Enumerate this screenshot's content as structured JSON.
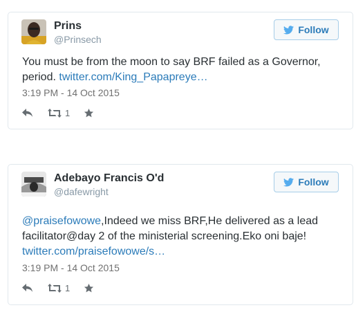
{
  "colors": {
    "link": "#2b7bb9",
    "follow_border": "#a6cde8",
    "card_border": "#e1e8ed",
    "meta_gray": "#8899a6",
    "action_gray": "#666d72"
  },
  "tweets": [
    {
      "name": "Prins",
      "handle": "@Prinsech",
      "follow_label": "Follow",
      "text": "You must be from the moon to say BRF failed as a Governor, period. ",
      "text_after_mention": "",
      "mention": "",
      "link": "twitter.com/King_Papapreye…",
      "time": "3:19 PM - 14 Oct 2015",
      "retweet_count": "1",
      "icons": [
        "reply-icon",
        "retweet-icon",
        "favorite-star-icon",
        "twitter-bird-icon"
      ]
    },
    {
      "name": "Adebayo Francis O'd",
      "handle": "@dafewright",
      "follow_label": "Follow",
      "mention": "@praisefowowe",
      "text_after_mention": ",Indeed we miss BRF,He delivered as a lead facilitator@day 2 of the ministerial screening.Eko oni baje! ",
      "text": "",
      "link": "twitter.com/praisefowowe/s…",
      "time": "3:19 PM - 14 Oct 2015",
      "retweet_count": "1",
      "icons": [
        "reply-icon",
        "retweet-icon",
        "favorite-star-icon",
        "twitter-bird-icon"
      ]
    }
  ]
}
